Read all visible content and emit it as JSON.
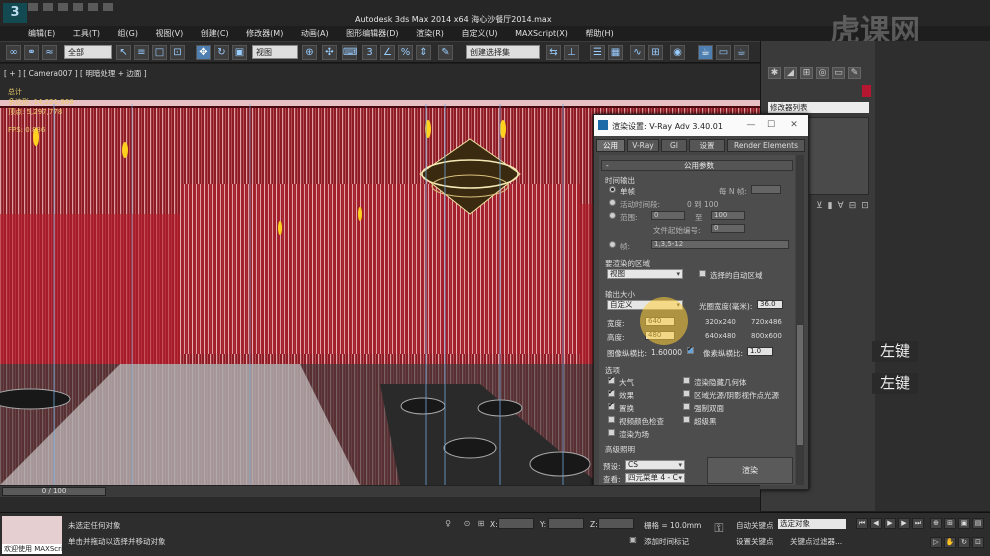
{
  "window": {
    "title": "Autodesk 3ds Max  2014 x64      海心沙餐厅2014.max",
    "logo": "3"
  },
  "menu": [
    "编辑(E)",
    "工具(T)",
    "组(G)",
    "视图(V)",
    "创建(C)",
    "修改器(M)",
    "动画(A)",
    "图形编辑器(D)",
    "渲染(R)",
    "自定义(U)",
    "MAXScript(X)",
    "帮助(H)"
  ],
  "toolbar": {
    "selection_filter": "全部",
    "ref_coord": "视图",
    "named_selection": "创建选择集"
  },
  "viewport": {
    "label": "[ + ] [ Camera007 ] [ 明暗处理 + 边面 ]",
    "stats": {
      "header": "总计",
      "polys": "多边形: 14,221,968",
      "verts": "顶点:    5,297,778",
      "fps": "FPS:       0.886"
    }
  },
  "command_panel": {
    "modifier_list": "修改器列表",
    "accent_color": "#b4172f"
  },
  "render_dialog": {
    "title": "渲染设置: V-Ray Adv 3.40.01",
    "tabs": [
      "公用",
      "V-Ray",
      "GI",
      "设置",
      "Render Elements"
    ],
    "rollout": "公用参数",
    "time_output": {
      "group": "时间输出",
      "single": "单帧",
      "every_n": "每 N 帧:",
      "active": "活动时间段:",
      "active_range": "0 到 100",
      "range": "范围:",
      "range_from": "0",
      "to": "至",
      "range_to": "100",
      "file_start": "文件起始编号:",
      "file_start_value": "0",
      "frames": "帧:",
      "frames_value": "1,3,5-12"
    },
    "area": {
      "group": "要渲染的区域",
      "value": "视图",
      "auto_region": "选择的自动区域"
    },
    "output_size": {
      "group": "输出大小",
      "preset": "自定义",
      "aperture_label": "光圈宽度(毫米):",
      "aperture": "36.0",
      "width_label": "宽度:",
      "width": "640",
      "height_label": "高度:",
      "height": "480",
      "presets": [
        "320x240",
        "720x486",
        "640x480",
        "800x600"
      ],
      "image_aspect_label": "图像纵横比:",
      "image_aspect": "1.60000",
      "pixel_aspect_label": "像素纵横比:",
      "pixel_aspect": "1.0"
    },
    "options": {
      "group": "选项",
      "atmosphere": "大气",
      "effects": "效果",
      "displacement": "置换",
      "video_check": "视频颜色检查",
      "render_to_fields": "渲染为场",
      "render_hidden": "渲染隐藏几何体",
      "area_lights": "区域光源/阴影视作点光源",
      "force_2sided": "强制双面",
      "super_black": "超级黑"
    },
    "advanced_lighting": "高级照明",
    "preset_label": "预设:",
    "preset_value": "CS",
    "view_label": "查看:",
    "view_value": "四元菜单 4 - C",
    "render_button": "渲染"
  },
  "overlay": {
    "left_click": "左键",
    "left_click2": "左键"
  },
  "watermark": "虎课网",
  "timeline": {
    "slider": "0 / 100"
  },
  "status": {
    "maxscript": "欢迎使用 MAXScri",
    "line1": "未选定任何对象",
    "line2": "单击并拖动以选择并移动对象",
    "x": "X:",
    "y": "Y:",
    "z": "Z:",
    "grid": "栅格 = 10.0mm",
    "add_time_tag": "添加时间标记",
    "auto_key": "自动关键点",
    "selected_object": "选定对象",
    "set_key": "设置关键点",
    "key_filters": "关键点过滤器..."
  }
}
